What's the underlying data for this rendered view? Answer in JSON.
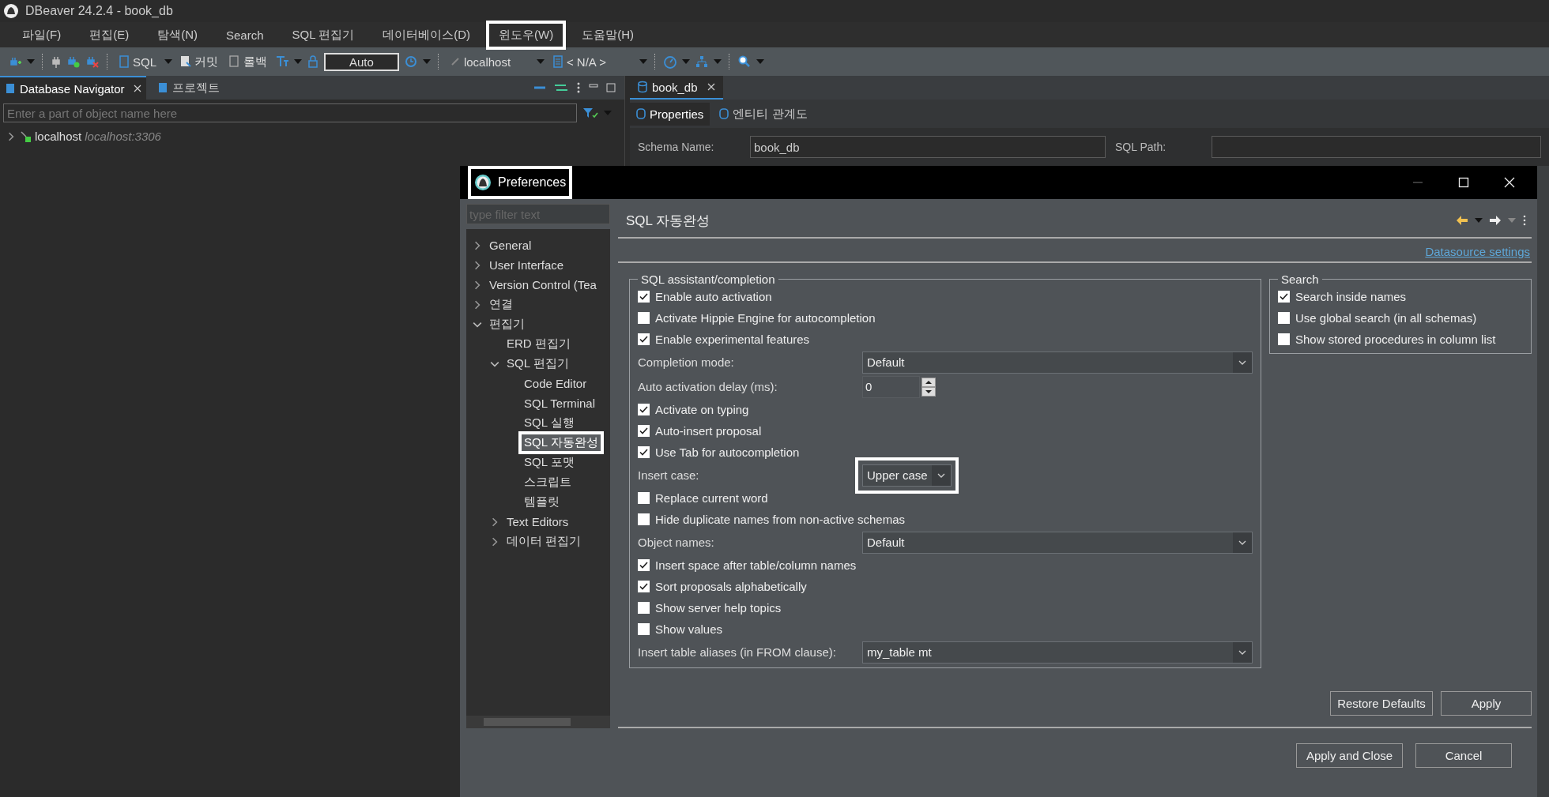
{
  "app_window": {
    "title": "DBeaver 24.2.4 - book_db"
  },
  "menu_bar": [
    {
      "label": "파일(F)",
      "highlighted": false
    },
    {
      "label": "편집(E)",
      "highlighted": false
    },
    {
      "label": "탐색(N)",
      "highlighted": false
    },
    {
      "label": "Search",
      "highlighted": false
    },
    {
      "label": "SQL 편집기",
      "highlighted": false
    },
    {
      "label": "데이터베이스(D)",
      "highlighted": false
    },
    {
      "label": "윈도우(W)",
      "highlighted": true
    },
    {
      "label": "도움말(H)",
      "highlighted": false
    }
  ],
  "toolbar": {
    "sql": "SQL",
    "commit": "커밋",
    "rollback": "롤백",
    "transaction_mode": "Auto",
    "connection": "localhost",
    "schema": "< N/A >"
  },
  "navigator": {
    "tabs": [
      {
        "label": "Database Navigator",
        "selected": true
      },
      {
        "label": "프로젝트",
        "selected": false
      }
    ],
    "filter": {
      "placeholder": "Enter a part of object name here"
    },
    "tree": [
      {
        "label": "localhost",
        "detail": "localhost:3306",
        "expanded": false
      }
    ]
  },
  "editor": {
    "tabs": [
      {
        "label": "book_db",
        "selected": true
      }
    ],
    "subtabs": [
      {
        "label": "Properties",
        "selected": true
      },
      {
        "label": "엔티티 관계도",
        "selected": false
      }
    ],
    "fields": [
      {
        "label": "Schema Name:",
        "value": "book_db"
      },
      {
        "label": "SQL Path:"
      }
    ]
  },
  "dialog": {
    "title": "Preferences",
    "highlighted": true,
    "filter": {
      "placeholder": "type filter text"
    },
    "tree": [
      {
        "label": "General",
        "expanded": false,
        "selected": false,
        "highlighted": false
      },
      {
        "label": "User Interface",
        "expanded": false,
        "selected": false,
        "highlighted": false
      },
      {
        "label": "Version Control (Tea",
        "expanded": false,
        "selected": false,
        "highlighted": false
      },
      {
        "label": "연결",
        "expanded": false,
        "selected": false,
        "highlighted": false
      },
      {
        "label": "편집기",
        "expanded": true,
        "selected": false,
        "highlighted": false,
        "children": [
          {
            "label": "ERD 편집기",
            "selected": false,
            "highlighted": false
          },
          {
            "label": "SQL 편집기",
            "expanded": true,
            "selected": false,
            "highlighted": false,
            "children": [
              {
                "label": "Code Editor",
                "selected": false,
                "highlighted": false
              },
              {
                "label": "SQL Terminal",
                "selected": false,
                "highlighted": false
              },
              {
                "label": "SQL 실행",
                "selected": false,
                "highlighted": false
              },
              {
                "label": "SQL 자동완성",
                "selected": true,
                "highlighted": true
              },
              {
                "label": "SQL 포맷",
                "selected": false,
                "highlighted": false
              },
              {
                "label": "스크립트",
                "selected": false,
                "highlighted": false
              },
              {
                "label": "템플릿",
                "selected": false,
                "highlighted": false
              }
            ]
          },
          {
            "label": "Text Editors",
            "expanded": false,
            "selected": false,
            "highlighted": false
          },
          {
            "label": "데이터 편집기",
            "expanded": false,
            "selected": false,
            "highlighted": false
          }
        ]
      }
    ],
    "page_title": "SQL 자동완성",
    "link": "Datasource settings",
    "groups": [
      {
        "title": "SQL assistant/completion",
        "items": [
          {
            "kind": "checkbox",
            "label": "Enable auto activation",
            "checked": true
          },
          {
            "kind": "checkbox",
            "label": "Activate Hippie Engine for autocompletion",
            "checked": false
          },
          {
            "kind": "checkbox",
            "label": "Enable experimental features",
            "checked": true
          },
          {
            "kind": "combo",
            "label": "Completion mode:",
            "value": "Default",
            "highlighted": false,
            "wide": true
          },
          {
            "kind": "spinner",
            "label": "Auto activation delay (ms):",
            "value": "0"
          },
          {
            "kind": "checkbox",
            "label": "Activate on typing",
            "checked": true
          },
          {
            "kind": "checkbox",
            "label": "Auto-insert proposal",
            "checked": true
          },
          {
            "kind": "checkbox",
            "label": "Use Tab for autocompletion",
            "checked": true
          },
          {
            "kind": "combo",
            "label": "Insert case:",
            "value": "Upper case",
            "highlighted": true,
            "wide": false
          },
          {
            "kind": "checkbox",
            "label": "Replace current word",
            "checked": false
          },
          {
            "kind": "checkbox",
            "label": "Hide duplicate names from non-active schemas",
            "checked": false
          },
          {
            "kind": "combo",
            "label": "Object names:",
            "value": "Default",
            "highlighted": false,
            "wide": true
          },
          {
            "kind": "checkbox",
            "label": "Insert space after table/column names",
            "checked": true
          },
          {
            "kind": "checkbox",
            "label": "Sort proposals alphabetically",
            "checked": true
          },
          {
            "kind": "checkbox",
            "label": "Show server help topics",
            "checked": false
          },
          {
            "kind": "checkbox",
            "label": "Show values",
            "checked": false
          },
          {
            "kind": "combo",
            "label": "Insert table aliases (in FROM clause):",
            "value": "my_table mt",
            "highlighted": false,
            "wide": true
          }
        ]
      },
      {
        "title": "Search",
        "items": [
          {
            "kind": "checkbox",
            "label": "Search inside names",
            "checked": true
          },
          {
            "kind": "checkbox",
            "label": "Use global search (in all schemas)",
            "checked": false
          },
          {
            "kind": "checkbox",
            "label": "Show stored procedures in column list",
            "checked": false
          }
        ]
      }
    ],
    "page_buttons": [
      "Restore Defaults",
      "Apply"
    ],
    "buttons": [
      "Apply and Close",
      "Cancel"
    ]
  }
}
